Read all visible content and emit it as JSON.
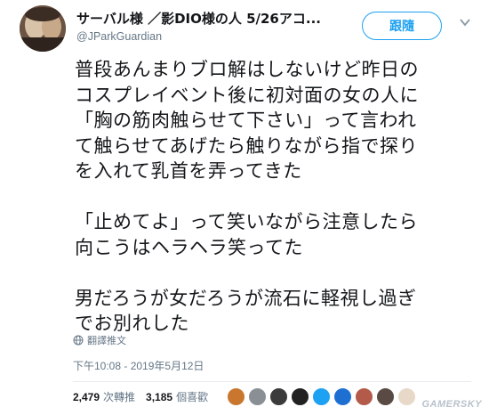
{
  "user": {
    "display_name": "サーバル様 ／影DIO様の人 5/26アコ...",
    "handle": "@JParkGuardian"
  },
  "follow_label": "跟隨",
  "tweet": {
    "text": "普段あんまりブロ解はしないけど昨日の\nコスプレイベント後に初対面の女の人に\n「胸の筋肉触らせて下さい」って言われ\nて触らせてあげたら触りながら指で探り\nを入れて乳首を弄ってきた\n\n「止めてよ」って笑いながら注意したら\n向こうはヘラヘラ笑ってた\n\n男だろうが女だろうが流石に軽視し過ぎ\nでお別れした",
    "translate_label": "翻譯推文",
    "timestamp": "下午10:08 - 2019年5月12日"
  },
  "stats": {
    "retweets_count": "2,479",
    "retweets_label": "次轉推",
    "likes_count": "3,185",
    "likes_label": "個喜歡"
  },
  "liker_avatars": [
    {
      "name": "liker-avatar-1",
      "color": "#c9772e"
    },
    {
      "name": "liker-avatar-2",
      "color": "#8a8f96"
    },
    {
      "name": "liker-avatar-3",
      "color": "#3b3b3b"
    },
    {
      "name": "liker-avatar-4",
      "color": "#222222"
    },
    {
      "name": "liker-avatar-5",
      "color": "#1da1f2"
    },
    {
      "name": "liker-avatar-6",
      "color": "#1d6fd1"
    },
    {
      "name": "liker-avatar-7",
      "color": "#b45a4a"
    },
    {
      "name": "liker-avatar-8",
      "color": "#5a4a44"
    },
    {
      "name": "liker-avatar-9",
      "color": "#e8d8c8"
    }
  ],
  "watermark": "GAMERSKY",
  "colors": {
    "accent": "#1da1f2",
    "text": "#14171a",
    "muted": "#657786"
  }
}
